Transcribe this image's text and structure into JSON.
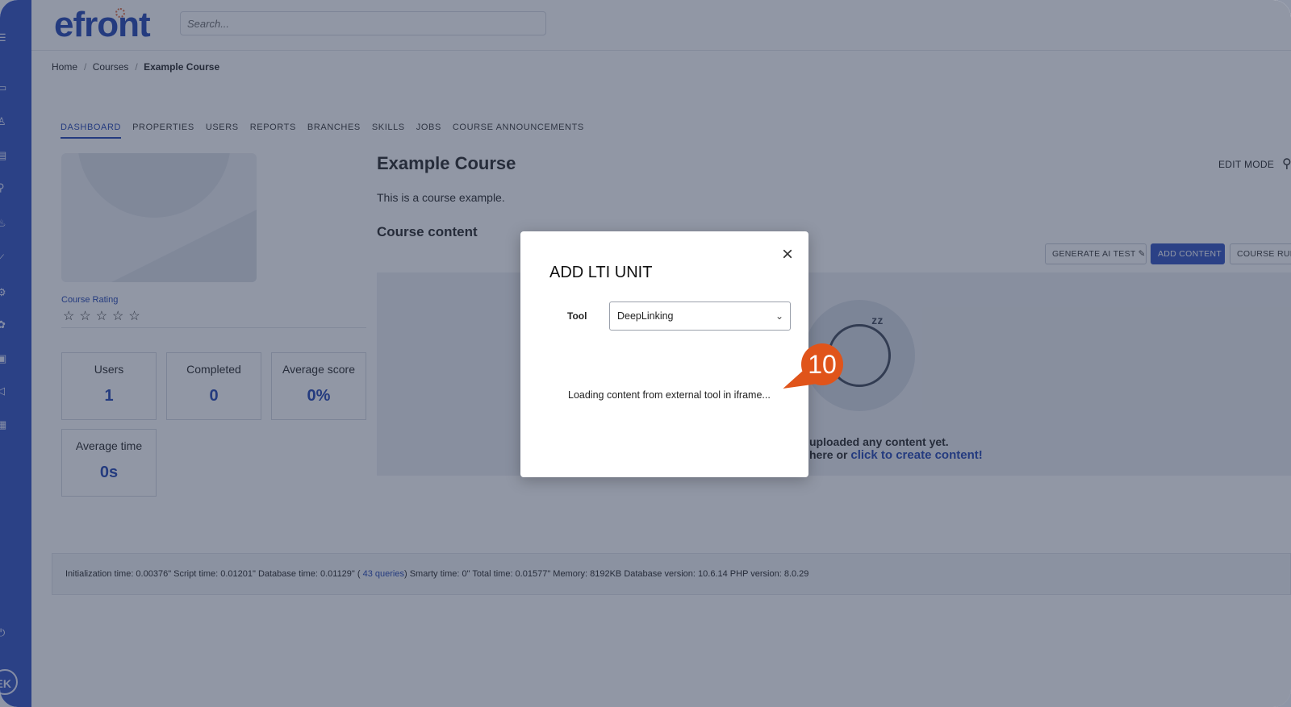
{
  "header": {
    "logo": "efront",
    "search_placeholder": "Search..."
  },
  "breadcrumb": [
    "Home",
    "Courses",
    "Example Course"
  ],
  "tabs": [
    "DASHBOARD",
    "PROPERTIES",
    "USERS",
    "REPORTS",
    "BRANCHES",
    "SKILLS",
    "JOBS",
    "COURSE ANNOUNCEMENTS"
  ],
  "left_panel": {
    "rating_label": "Course Rating",
    "stats": [
      {
        "label": "Users",
        "value": "1"
      },
      {
        "label": "Completed",
        "value": "0"
      },
      {
        "label": "Average score",
        "value": "0%"
      },
      {
        "label": "Average time",
        "value": "0s"
      }
    ]
  },
  "main": {
    "title": "Example Course",
    "description": "This is a course example.",
    "section_title": "Course content",
    "edit_mode": "EDIT MODE",
    "buttons": {
      "generate_ai": "GENERATE AI TEST",
      "add_content": "ADD CONTENT",
      "course_rules": "COURSE RULE"
    },
    "empty_line1": "uploaded any content yet.",
    "empty_line2_prefix": "here or ",
    "empty_link": "click to create content!"
  },
  "footer": {
    "text_before": "Initialization time: 0.00376\" Script time: 0.01201\" Database time: 0.01129\" (",
    "queries": " 43 queries",
    "text_after": ") Smarty time: 0\" Total time: 0.01577\" Memory: 8192KB Database version: 10.6.14 PHP version: 8.0.29"
  },
  "sidebar": {
    "avatar": "EK"
  },
  "modal": {
    "title": "ADD LTI UNIT",
    "tool_label": "Tool",
    "tool_value": "DeepLinking",
    "loading_text": "Loading content from external tool in iframe..."
  },
  "badge": {
    "number": "10"
  },
  "colors": {
    "primary": "#3d5bc4",
    "badge": "#e0541a"
  }
}
